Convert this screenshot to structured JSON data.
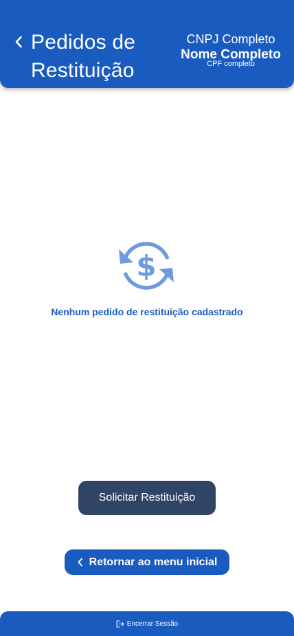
{
  "header": {
    "title": "Pedidos de Restituição",
    "back_icon": "chevron-left-icon",
    "cnpj": "CNPJ Completo",
    "nome": "Nome Completo",
    "cpf": "CPF completo"
  },
  "empty_state": {
    "icon": "refund-dollar-icon",
    "message": "Nenhum pedido de restituição cadastrado"
  },
  "actions": {
    "request_label": "Solicitar Restituição",
    "return_label": "Retornar ao menu inicial"
  },
  "footer": {
    "logout_icon": "logout-icon",
    "logout_label": "Encerrar Sessão"
  },
  "colors": {
    "primary": "#1a5bbf",
    "dark_button": "#304466",
    "icon": "#6e9bdf"
  }
}
